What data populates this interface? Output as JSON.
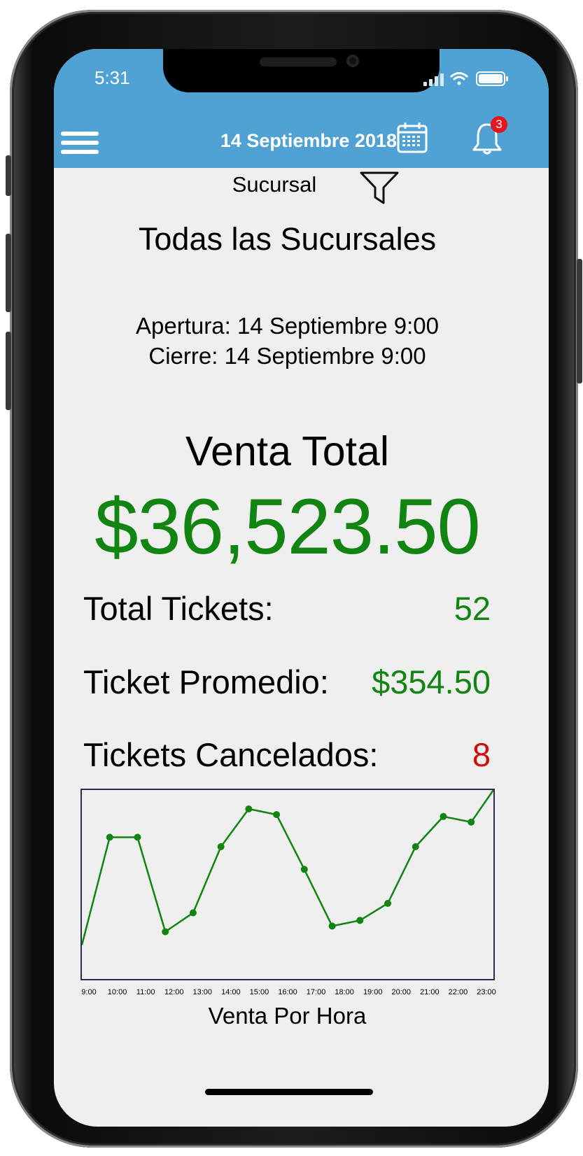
{
  "status_bar": {
    "time": "5:31"
  },
  "header": {
    "date": "14 Septiembre 2018",
    "notification_count": "3",
    "colors": {
      "bar": "#4fa2d3",
      "badge": "#e8141b"
    }
  },
  "filter": {
    "label": "Sucursal"
  },
  "branch": "Todas las Sucursales",
  "hours": {
    "open": "Apertura: 14 Septiembre 9:00",
    "close": "Cierre: 14 Septiembre 9:00"
  },
  "summary": {
    "title": "Venta Total",
    "total": "$36,523.50",
    "tickets_label": "Total Tickets:",
    "tickets_value": "52",
    "avg_label": "Ticket Promedio:",
    "avg_value": "$354.50",
    "cancel_label": "Tickets Cancelados:",
    "cancel_value": "8",
    "colors": {
      "positive": "#118411",
      "negative": "#d20b0b"
    }
  },
  "chart_data": {
    "type": "line",
    "title": "",
    "xlabel": "Venta Por Hora",
    "ylabel": "",
    "x_ticks": [
      "9:00",
      "10:00",
      "11:00",
      "12:00",
      "13:00",
      "14:00",
      "15:00",
      "16:00",
      "17:00",
      "18:00",
      "19:00",
      "20:00",
      "21:00",
      "22:00",
      "23:00"
    ],
    "x": [
      9,
      10,
      11,
      12,
      13,
      14,
      15,
      16,
      17,
      18,
      19,
      20,
      21,
      22,
      23
    ],
    "values": [
      0.18,
      0.75,
      0.75,
      0.25,
      0.35,
      0.7,
      0.9,
      0.87,
      0.58,
      0.28,
      0.31,
      0.4,
      0.7,
      0.86,
      0.83,
      1.0
    ],
    "x_points": [
      9,
      10,
      11,
      12,
      13,
      14,
      15,
      16,
      17,
      18,
      19,
      20,
      21,
      22,
      23,
      23.8
    ],
    "ylim": [
      0,
      1
    ],
    "grid": false,
    "color": "#118411",
    "caption": "Venta Por Hora"
  }
}
